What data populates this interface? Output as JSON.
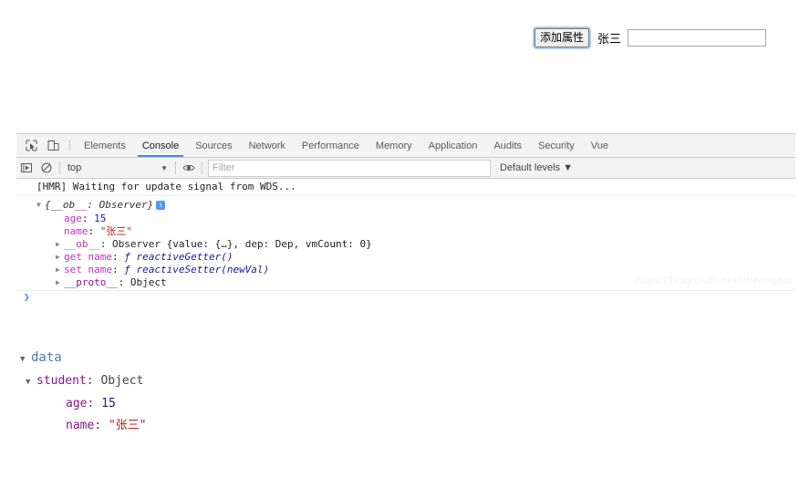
{
  "page": {
    "add_property_button": "添加属性",
    "name_label": "张三",
    "name_input_value": "",
    "name_input_placeholder": ""
  },
  "devtools": {
    "icons": {
      "inspect": "inspect-element-icon",
      "device": "device-toolbar-icon",
      "execute": "execute-script-icon",
      "clear": "clear-console-icon",
      "eye": "console-sidebar-eye-icon"
    },
    "tabs": [
      {
        "label": "Elements",
        "active": false
      },
      {
        "label": "Console",
        "active": true
      },
      {
        "label": "Sources",
        "active": false
      },
      {
        "label": "Network",
        "active": false
      },
      {
        "label": "Performance",
        "active": false
      },
      {
        "label": "Memory",
        "active": false
      },
      {
        "label": "Application",
        "active": false
      },
      {
        "label": "Audits",
        "active": false
      },
      {
        "label": "Security",
        "active": false
      },
      {
        "label": "Vue",
        "active": false
      }
    ],
    "filterbar": {
      "context": "top",
      "context_arrow": "▼",
      "filter_placeholder": "Filter",
      "filter_value": "",
      "levels": "Default levels ▼"
    },
    "console": {
      "hmr_message": "[HMR] Waiting for update signal from WDS...",
      "object_header": "{__ob__: Observer}",
      "rows": [
        {
          "indent": 2,
          "arrow": "",
          "key": "age",
          "sep": ": ",
          "value": "15",
          "value_class": "num"
        },
        {
          "indent": 2,
          "arrow": "",
          "key": "name",
          "sep": ": ",
          "value": "\"张三\"",
          "value_class": "str"
        },
        {
          "indent": 1,
          "arrow": "▶",
          "key": "__ob__",
          "sep": ": ",
          "value": "Observer {value: {…}, dep: Dep, vmCount: 0}",
          "value_class": "observer"
        },
        {
          "indent": 1,
          "arrow": "▶",
          "key": "get name",
          "sep": ": ",
          "value": "ƒ reactiveGetter()",
          "value_class": "fn"
        },
        {
          "indent": 1,
          "arrow": "▶",
          "key": "set name",
          "sep": ": ",
          "value": "ƒ reactiveSetter(newVal)",
          "value_class": "fn"
        },
        {
          "indent": 1,
          "arrow": "▶",
          "key": "__proto__",
          "sep": ": ",
          "value": "Object",
          "value_class": "plain"
        }
      ],
      "prompt": "❯"
    },
    "watermark": "https://blog.csdn.net/hhkongbai"
  },
  "vue_data": {
    "root_label": "data",
    "root_arrow": "▼",
    "student_arrow": "▼",
    "student_key": "student",
    "student_type": "Object",
    "props": [
      {
        "key": "age",
        "value": "15",
        "kind": "num"
      },
      {
        "key": "name",
        "value": "\"张三\"",
        "kind": "str"
      }
    ]
  },
  "colors": {
    "accent": "#4286f5",
    "string": "#c41a16",
    "number": "#1a1aa6",
    "property": "#881391",
    "panel_bg": "#f3f3f3"
  }
}
